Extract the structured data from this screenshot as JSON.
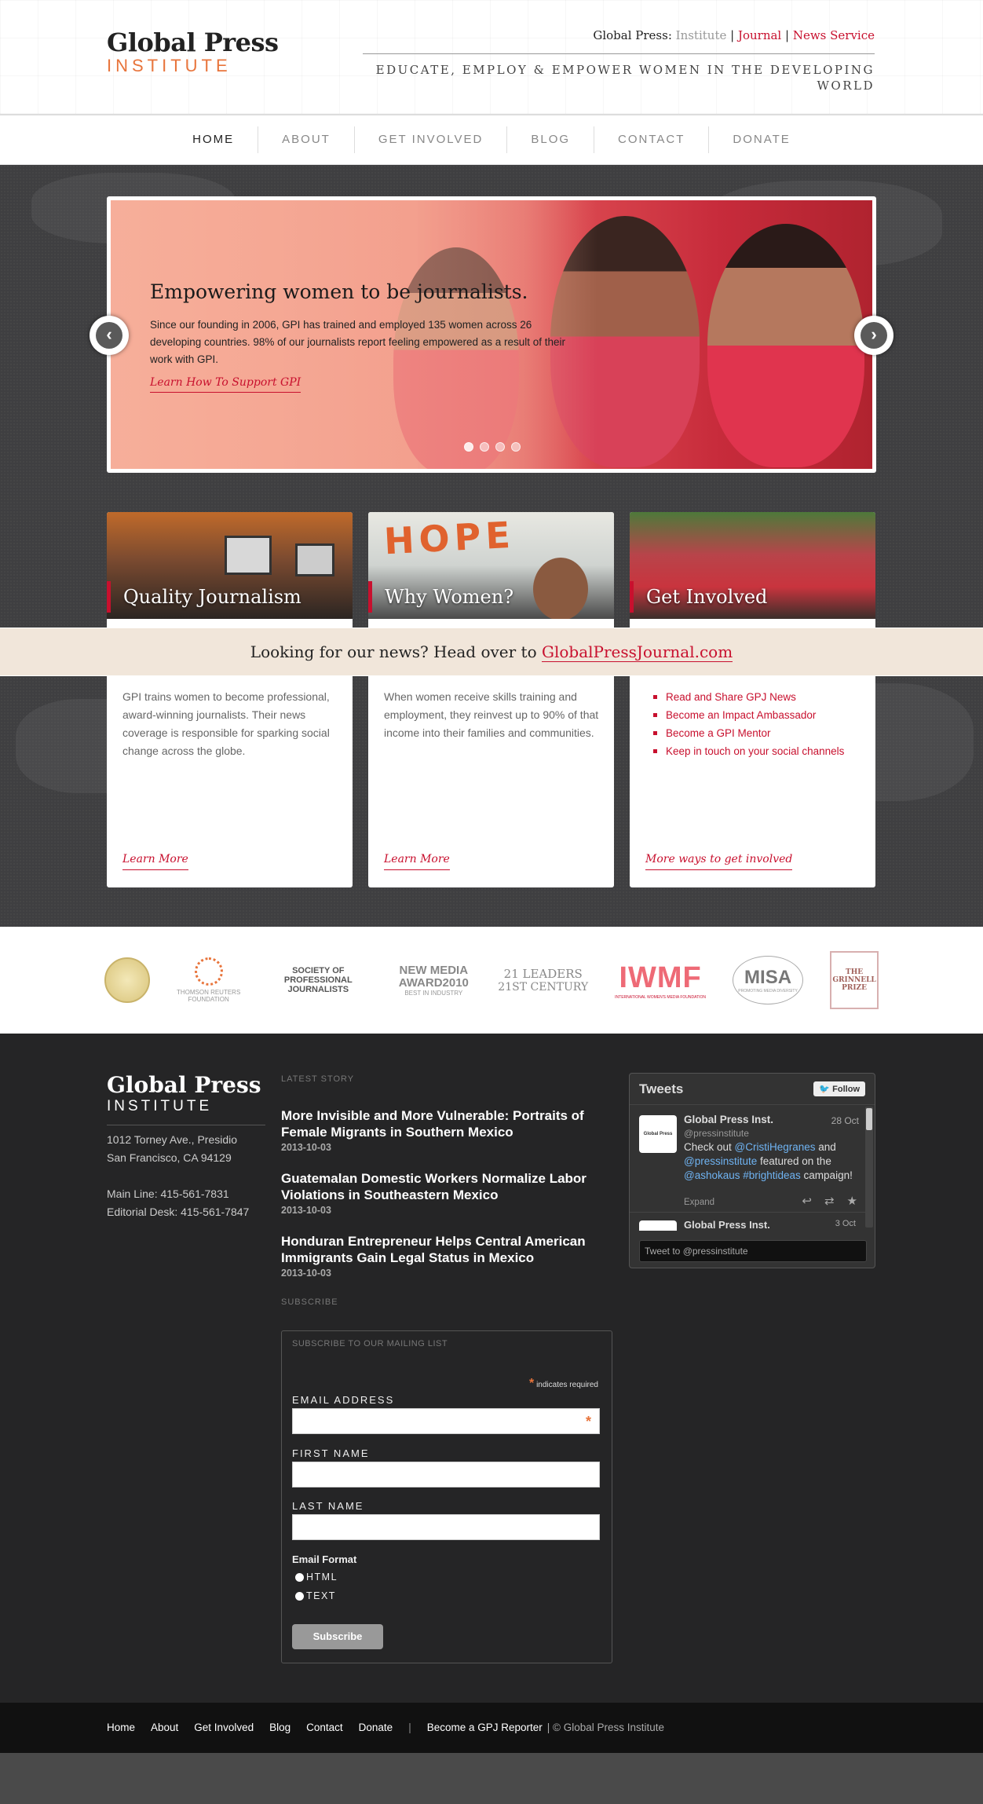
{
  "header": {
    "logo_main": "Global Press",
    "logo_sub": "INSTITUTE",
    "top_prefix": "Global Press: ",
    "top_institute": "Institute",
    "top_journal": "Journal",
    "top_news": "News Service",
    "tagline": "EDUCATE, EMPLOY & EMPOWER WOMEN IN THE DEVELOPING WORLD"
  },
  "nav": [
    "HOME",
    "ABOUT",
    "GET INVOLVED",
    "BLOG",
    "CONTACT",
    "DONATE"
  ],
  "slider": {
    "title": "Empowering women to be journalists.",
    "text": "Since our founding in 2006, GPI has trained and employed 135 women across 26 developing countries. 98% of our journalists report feeling empowered as a result of their work with GPI.",
    "link": "Learn How To Support GPI",
    "prev": "‹",
    "next": "›"
  },
  "boxes": [
    {
      "title": "Quality Journalism",
      "body": "GPI trains women to become professional, award-winning journalists. Their news coverage is responsible for sparking social change across the globe.",
      "link": "Learn More"
    },
    {
      "title": "Why Women?",
      "body": "When women receive skills training and employment, they reinvest up to 90% of that income into their families and communities.",
      "link": "Learn More",
      "img_text": "HOPE"
    },
    {
      "title": "Get Involved",
      "list": [
        "Read and Share GPJ News",
        "Become an Impact Ambassador",
        "Become a GPI Mentor",
        "Keep in touch on your social channels"
      ],
      "link": "More ways to get involved"
    }
  ],
  "newsbar": {
    "text": "Looking for our news? Head over to ",
    "link": "GlobalPressJournal.com"
  },
  "partners": [
    {
      "name": "THOMSON REUTERS",
      "sub": "FOUNDATION"
    },
    {
      "name": "SOCIETY OF PROFESSIONAL JOURNALISTS"
    },
    {
      "name": "NEW MEDIA AWARD2010",
      "sub": "BEST IN INDUSTRY"
    },
    {
      "name": "21 LEADERS",
      "sub": "21ST CENTURY"
    },
    {
      "name": "IWMF",
      "sub": "INTERNATIONAL WOMEN'S MEDIA FOUNDATION"
    },
    {
      "name": "MISA",
      "sub": "PROMOTING MEDIA DIVERSITY"
    },
    {
      "name": "THE GRINNELL PRIZE"
    }
  ],
  "footer": {
    "logo_main": "Global Press",
    "logo_sub": "INSTITUTE",
    "address1": "1012 Torney Ave., Presidio",
    "address2": "San Francisco, CA 94129",
    "mainline": "Main Line: 415-561-7831",
    "editorial": "Editorial Desk: 415-561-7847",
    "latest_head": "LATEST STORY",
    "stories": [
      {
        "title": "More Invisible and More Vulnerable: Portraits of Female Migrants in Southern Mexico",
        "date": "2013-10-03"
      },
      {
        "title": "Guatemalan Domestic Workers Normalize Labor Violations in Southeastern Mexico",
        "date": "2013-10-03"
      },
      {
        "title": "Honduran Entrepreneur Helps Central American Immigrants Gain Legal Status in Mexico",
        "date": "2013-10-03"
      }
    ],
    "subscribe_head": "SUBSCRIBE"
  },
  "mailing": {
    "heading": "SUBSCRIBE TO OUR MAILING LIST",
    "required": "indicates required",
    "email_label": "EMAIL ADDRESS",
    "first_label": "FIRST NAME",
    "last_label": "LAST NAME",
    "format_label": "Email Format",
    "opt_html": "HTML",
    "opt_text": "TEXT",
    "button": "Subscribe"
  },
  "tweets": {
    "title": "Tweets",
    "follow": "Follow",
    "name": "Global Press Inst.",
    "handle": "@pressinstitute",
    "date": "28 Oct",
    "text_1": "Check out ",
    "mention_1": "@CristiHegranes",
    "text_2": " and ",
    "mention_2": "@pressinstitute",
    "text_3": " featured on the ",
    "mention_3": "@ashokaus #brightideas",
    "text_4": " campaign!",
    "expand": "Expand",
    "next_name": "Global Press Inst.",
    "next_date": "3 Oct",
    "avatar_text": "Global Press",
    "input": "Tweet to @pressinstitute"
  },
  "bottom": {
    "links": [
      "Home",
      "About",
      "Get Involved",
      "Blog",
      "Contact",
      "Donate"
    ],
    "reporter": "Become a GPJ Reporter",
    "copyright": "| © Global Press Institute"
  },
  "colors": {
    "accent": "#c8102e",
    "logo_orange": "#e8743b",
    "news_bar": "#f1e6da"
  }
}
